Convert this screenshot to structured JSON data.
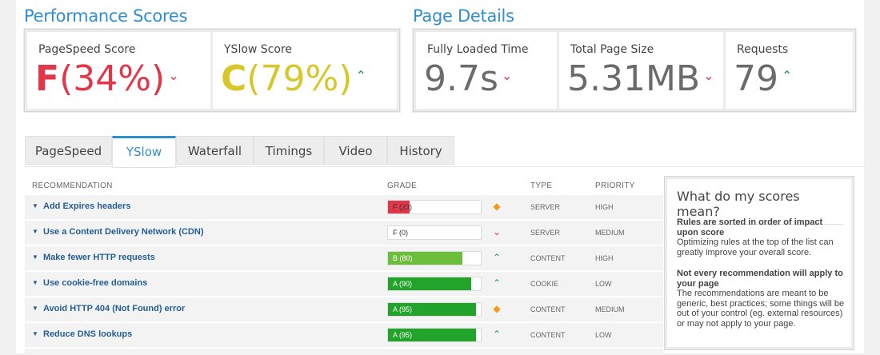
{
  "performance": {
    "title": "Performance Scores",
    "pagespeed": {
      "label": "PageSpeed Score",
      "letter": "F",
      "percent": "(34%)",
      "trend": "down",
      "color": "#e2374b"
    },
    "yslow": {
      "label": "YSlow Score",
      "letter": "C",
      "percent": "(79%)",
      "trend": "up",
      "color": "#d8c72a"
    }
  },
  "details": {
    "title": "Page Details",
    "loaded": {
      "label": "Fully Loaded Time",
      "value": "9.7s",
      "trend": "down"
    },
    "size": {
      "label": "Total Page Size",
      "value": "5.31MB",
      "trend": "down"
    },
    "requests": {
      "label": "Requests",
      "value": "79",
      "trend": "up"
    }
  },
  "tabs": [
    "PageSpeed",
    "YSlow",
    "Waterfall",
    "Timings",
    "Video",
    "History"
  ],
  "active_tab": "YSlow",
  "table": {
    "headers": {
      "recommendation": "RECOMMENDATION",
      "grade": "GRADE",
      "type": "TYPE",
      "priority": "PRIORITY"
    },
    "rows": [
      {
        "rec": "Add Expires headers",
        "grade": "F (23)",
        "score": 23,
        "color": "#e2374b",
        "indicator": "diamond",
        "type": "SERVER",
        "priority": "HIGH"
      },
      {
        "rec": "Use a Content Delivery Network (CDN)",
        "grade": "F (0)",
        "score": 0,
        "color": "#e2374b",
        "indicator": "down",
        "type": "SERVER",
        "priority": "MEDIUM"
      },
      {
        "rec": "Make fewer HTTP requests",
        "grade": "B (80)",
        "score": 80,
        "color": "#6cbf3a",
        "indicator": "up",
        "type": "CONTENT",
        "priority": "HIGH"
      },
      {
        "rec": "Use cookie-free domains",
        "grade": "A (90)",
        "score": 90,
        "color": "#22a32a",
        "indicator": "up",
        "type": "COOKIE",
        "priority": "LOW"
      },
      {
        "rec": "Avoid HTTP 404 (Not Found) error",
        "grade": "A (95)",
        "score": 95,
        "color": "#22a32a",
        "indicator": "diamond",
        "type": "CONTENT",
        "priority": "MEDIUM"
      },
      {
        "rec": "Reduce DNS lookups",
        "grade": "A (95)",
        "score": 95,
        "color": "#22a32a",
        "indicator": "up",
        "type": "CONTENT",
        "priority": "LOW"
      }
    ]
  },
  "sidebar": {
    "title": "What do my scores mean?",
    "block1_title": "Rules are sorted in order of impact upon score",
    "block1_text": "Optimizing rules at the top of the list can greatly improve your overall score.",
    "block2_title": "Not every recommendation will apply to your page",
    "block2_text": "The recommendations are meant to be generic, best practices; some things will be out of your control (eg. external resources) or may not apply to your page."
  },
  "icons": {
    "trend_down": "chevron-down-icon",
    "trend_up": "chevron-up-icon",
    "diamond": "diamond-icon",
    "caret": "caret-down-icon"
  }
}
